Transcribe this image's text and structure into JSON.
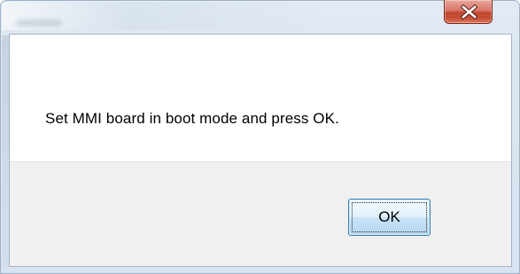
{
  "window": {
    "title": ""
  },
  "title_bar": {
    "close_icon": "close-icon"
  },
  "dialog": {
    "message": "Set MMI board in boot mode and press OK.",
    "ok_label": "OK"
  },
  "colors": {
    "close_button": "#c64f39",
    "button_bar": "#f0f0f0",
    "ok_border": "#3c7fb1"
  }
}
